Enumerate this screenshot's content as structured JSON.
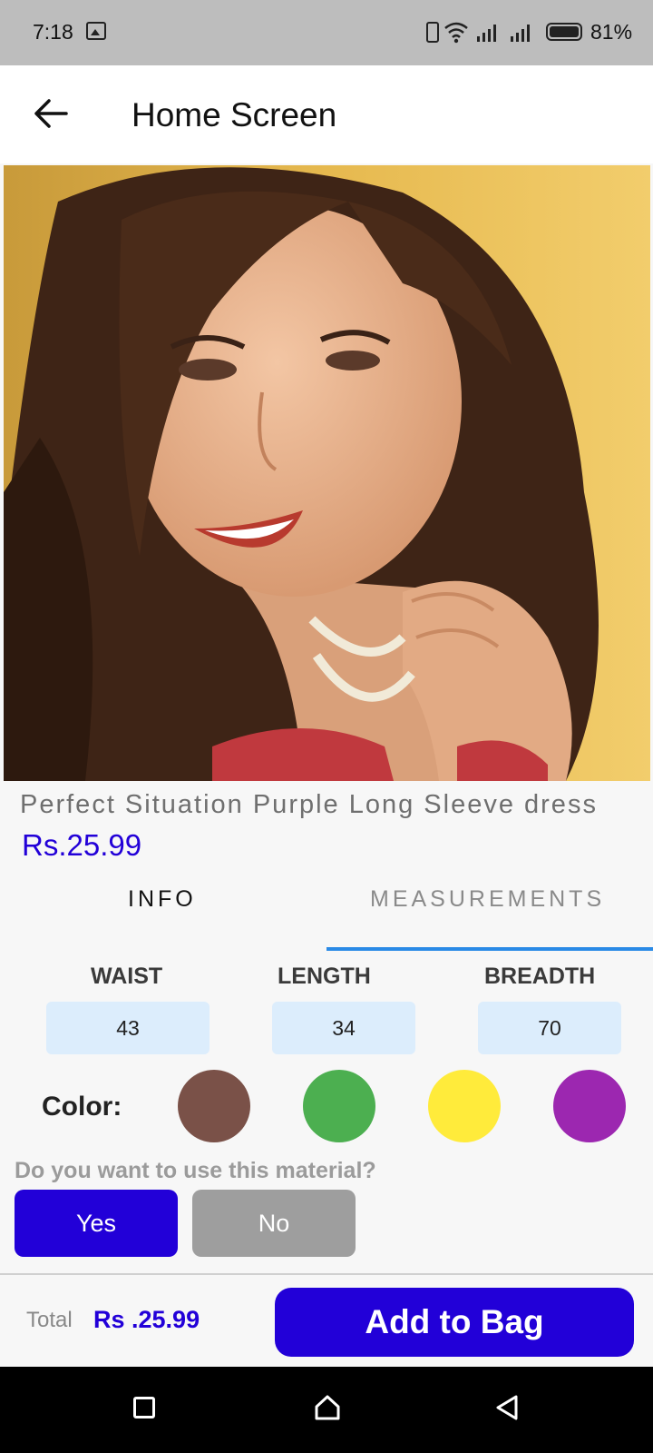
{
  "status_bar": {
    "time": "7:18",
    "battery": "81%",
    "icons": [
      "gallery-icon",
      "phone-icon",
      "wifi-icon",
      "signal-icon",
      "battery-icon"
    ]
  },
  "app_bar": {
    "title": "Home Screen",
    "back_icon": "arrow-left-icon"
  },
  "product": {
    "image": "product-photo",
    "name": "Perfect Situation Purple Long Sleeve dress",
    "price": "Rs.25.99"
  },
  "tabs": [
    {
      "label": "INFO",
      "selected": false
    },
    {
      "label": "MEASUREMENTS",
      "selected": true
    }
  ],
  "measurements": {
    "headers": [
      "WAIST",
      "LENGTH",
      "BREADTH"
    ],
    "values": [
      "43",
      "34",
      "70"
    ]
  },
  "color": {
    "label": "Color:",
    "swatches": [
      "#7a5148",
      "#4caf50",
      "#ffeb3b",
      "#9c27b0"
    ]
  },
  "material": {
    "question": "Do you want to use this material?",
    "yes_label": "Yes",
    "no_label": "No"
  },
  "footer": {
    "total_label": "Total",
    "total_value": "Rs .25.99",
    "add_to_bag_label": "Add to Bag"
  },
  "accent_color": "#2200d8",
  "nav_bar": {
    "icons": [
      "recents-icon",
      "home-icon",
      "back-icon"
    ]
  }
}
